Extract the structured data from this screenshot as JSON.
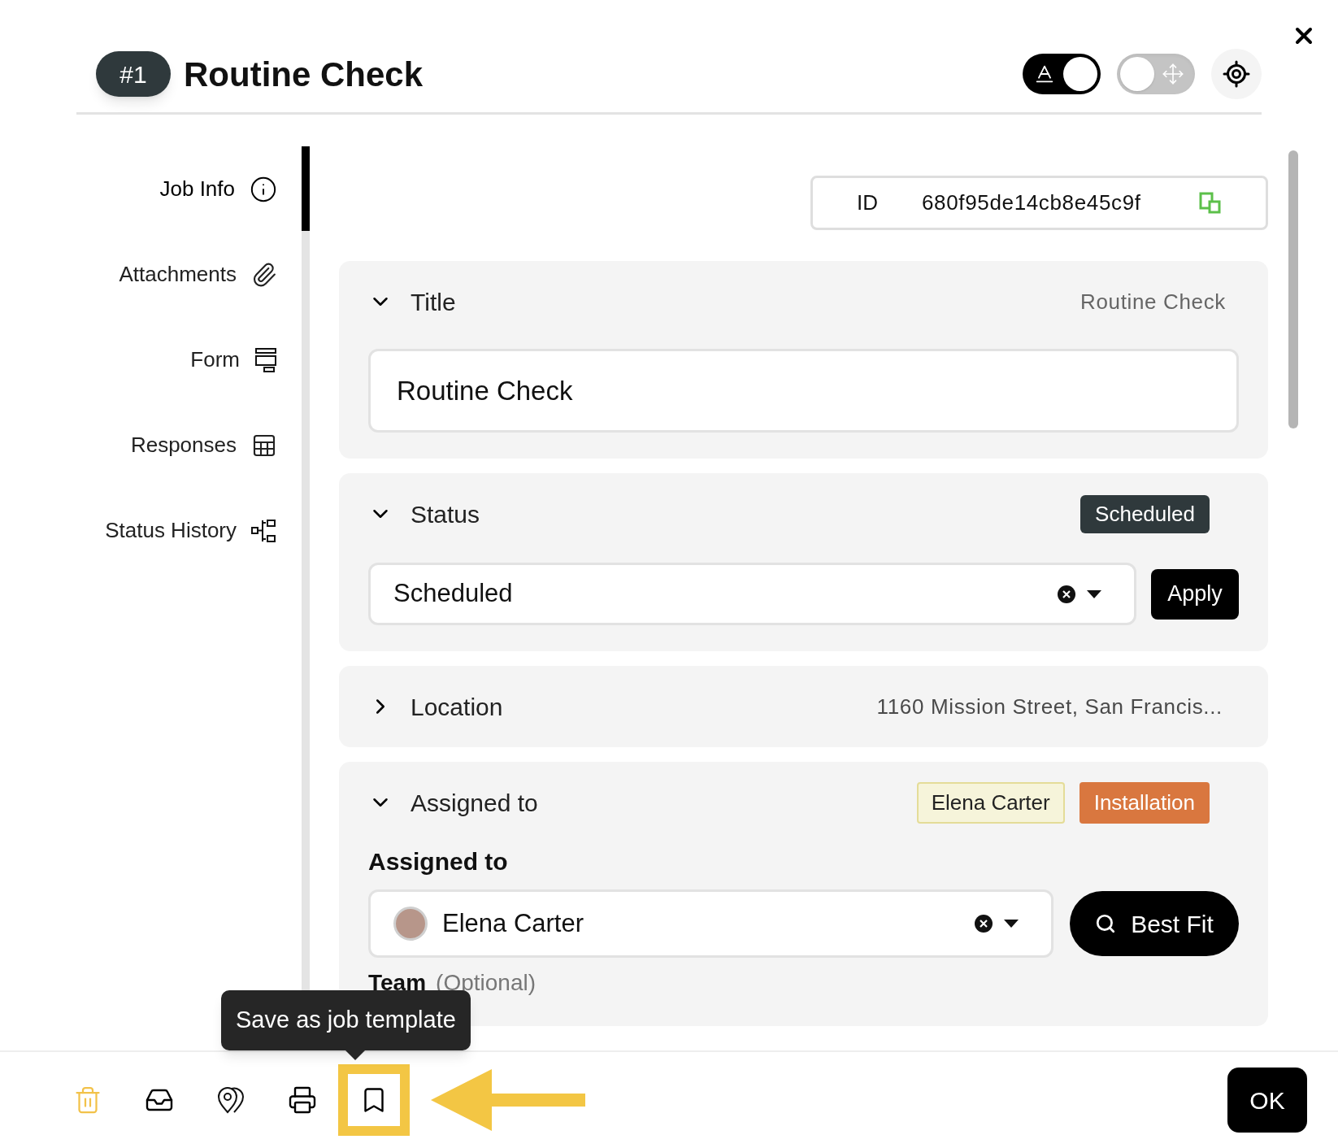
{
  "header": {
    "badge": "#1",
    "title": "Routine Check"
  },
  "toggles": [
    {
      "kind": "text",
      "on": true
    },
    {
      "kind": "move",
      "on": false
    }
  ],
  "sidebar": {
    "items": [
      {
        "label": "Job Info",
        "selected": true
      },
      {
        "label": "Attachments",
        "selected": false
      },
      {
        "label": "Form",
        "selected": false
      },
      {
        "label": "Responses",
        "selected": false
      },
      {
        "label": "Status History",
        "selected": false
      }
    ]
  },
  "id_field": {
    "label": "ID",
    "value": "680f95de14cb8e45c9f"
  },
  "sections": [
    {
      "kind": "text",
      "label": "Title",
      "expanded": true,
      "summary": "Routine Check",
      "value": "Routine Check"
    },
    {
      "kind": "status",
      "label": "Status",
      "expanded": true,
      "badge": "Scheduled",
      "value": "Scheduled",
      "button": "Apply"
    },
    {
      "kind": "summary",
      "label": "Location",
      "expanded": false,
      "summary": "1160 Mission Street, San Francis..."
    },
    {
      "kind": "assign",
      "label": "Assigned to",
      "expanded": true,
      "tags": [
        {
          "text": "Elena Carter",
          "color": "#f6f4da"
        },
        {
          "text": "Installation",
          "color": "#d9773f"
        }
      ],
      "field_label": "Assigned to",
      "value": "Elena Carter",
      "button": "Best Fit",
      "next_label": "Team",
      "next_hint": "(Optional)"
    }
  ],
  "footer": {
    "tools": [
      {
        "kind": "delete",
        "highlighted": false
      },
      {
        "kind": "inbox",
        "highlighted": false
      },
      {
        "kind": "pins",
        "highlighted": false
      },
      {
        "kind": "print",
        "highlighted": false
      },
      {
        "kind": "bookmark",
        "highlighted": true
      }
    ],
    "tooltip": "Save as job template",
    "ok": "OK"
  }
}
